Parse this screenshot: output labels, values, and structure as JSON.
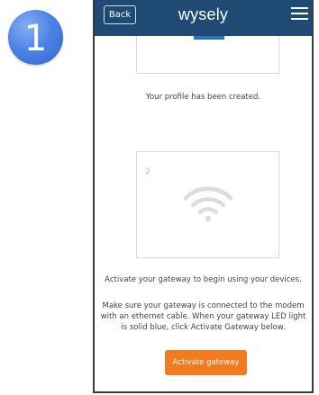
{
  "step": {
    "number": "1"
  },
  "header": {
    "back_label": "Back",
    "logo": "wysely",
    "menu_icon": "hamburger-menu-icon",
    "background_color": "#1f4a73"
  },
  "main": {
    "profile_message": "Your profile has been created.",
    "gateway_card": {
      "number": "2",
      "icon": "wifi-icon"
    },
    "activate_prompt": "Activate your gateway to begin using your devices.",
    "instructions": "Make sure your gateway is connected to the modem with an ethernet cable. When your gateway LED light is solid blue, click Activate Gateway below.",
    "activate_button_label": "Activate gateway",
    "accent_color": "#f47a20"
  }
}
